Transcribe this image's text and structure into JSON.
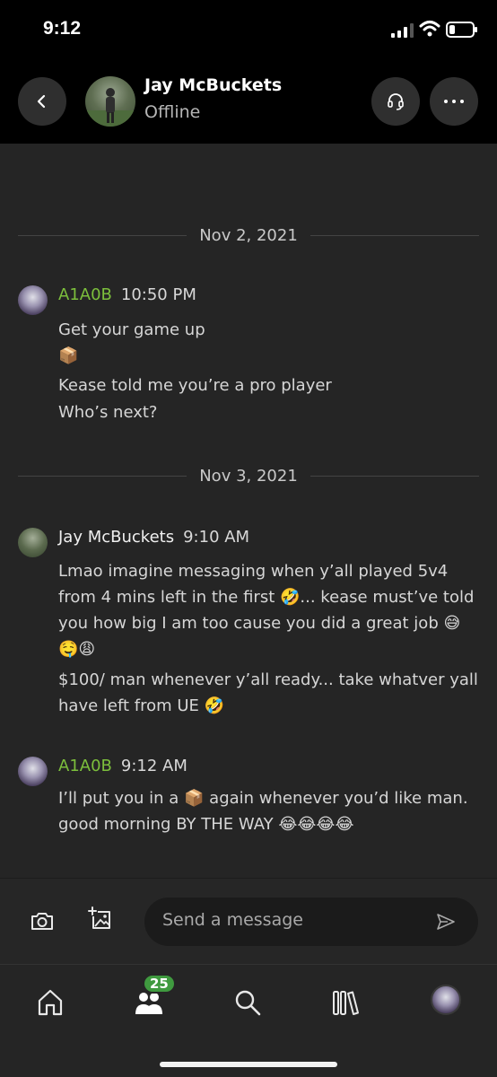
{
  "status_bar": {
    "time": "9:12"
  },
  "header": {
    "name": "Jay McBuckets",
    "presence": "Offline",
    "icons": {
      "back": "chevron-left-icon",
      "party": "headset-icon",
      "more": "more-horizontal-icon"
    }
  },
  "conversation": {
    "date_1": "Nov 2, 2021",
    "date_2": "Nov 3, 2021",
    "groups": [
      {
        "sender": "A1A0B",
        "time": "10:50 PM",
        "lines": [
          "Get your game up",
          "📦",
          "Kease told me you’re a pro player",
          "Who’s next?"
        ]
      },
      {
        "sender": "Jay McBuckets",
        "time": "9:10 AM",
        "lines": [
          "Lmao imagine messaging when y’all played 5v4 from 4 mins left in the first 🤣... kease must’ve told you how big I am too cause you did a great job 😅🤤😩",
          "$100/ man whenever y’all ready... take whatver yall have left from UE 🤣"
        ]
      },
      {
        "sender": "A1A0B",
        "time": "9:12 AM",
        "lines": [
          "I’ll put you in a 📦 again whenever you’d like man. good morning BY THE WAY 😂😂😂😂"
        ]
      }
    ]
  },
  "composer": {
    "placeholder": "Send a message",
    "icons": {
      "camera": "camera-icon",
      "image": "add-image-icon",
      "send": "send-icon"
    }
  },
  "bottom_nav": {
    "badge_count": "25",
    "items": [
      "home-icon",
      "people-icon",
      "search-icon",
      "library-icon",
      "profile-avatar"
    ]
  },
  "colors": {
    "gamertag_green": "#7cbf3c",
    "badge_green": "#3f9a3f",
    "background": "#252525",
    "header": "#000000"
  }
}
